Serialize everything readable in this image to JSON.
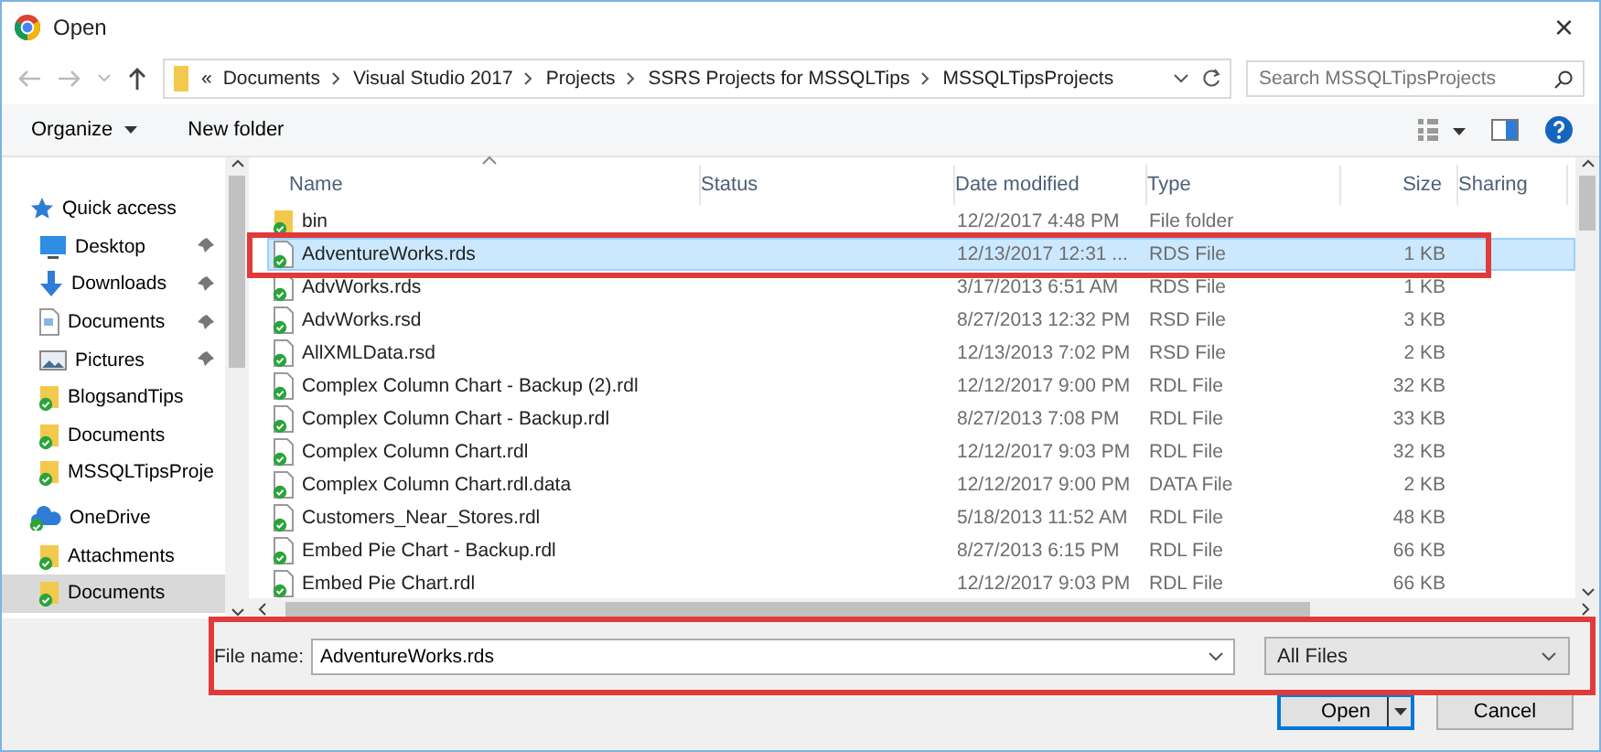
{
  "window": {
    "title": "Open",
    "close": "×"
  },
  "nav": {
    "path_prefix": "«",
    "path": [
      "Documents",
      "Visual Studio 2017",
      "Projects",
      "SSRS Projects for MSSQLTips",
      "MSSQLTipsProjects"
    ],
    "search_placeholder": "Search MSSQLTipsProjects"
  },
  "toolbar": {
    "organize": "Organize",
    "new_folder": "New folder"
  },
  "sidebar": {
    "items": [
      {
        "label": "Quick access",
        "kind": "star",
        "pinned": false,
        "selected": false,
        "top": true
      },
      {
        "label": "Desktop",
        "kind": "desktop",
        "pinned": true,
        "selected": false,
        "top": false
      },
      {
        "label": "Downloads",
        "kind": "download",
        "pinned": true,
        "selected": false,
        "top": false
      },
      {
        "label": "Documents",
        "kind": "document",
        "pinned": true,
        "selected": false,
        "top": false
      },
      {
        "label": "Pictures",
        "kind": "picture",
        "pinned": true,
        "selected": false,
        "top": false
      },
      {
        "label": "BlogsandTips",
        "kind": "folder",
        "pinned": false,
        "selected": false,
        "top": false
      },
      {
        "label": "Documents",
        "kind": "folder",
        "pinned": false,
        "selected": false,
        "top": false
      },
      {
        "label": "MSSQLTipsProje",
        "kind": "folder",
        "pinned": false,
        "selected": false,
        "top": false
      },
      {
        "label": "OneDrive",
        "kind": "cloud",
        "pinned": false,
        "selected": false,
        "top": true
      },
      {
        "label": "Attachments",
        "kind": "folder",
        "pinned": false,
        "selected": false,
        "top": false
      },
      {
        "label": "Documents",
        "kind": "folder",
        "pinned": false,
        "selected": true,
        "top": false
      }
    ]
  },
  "table": {
    "columns": [
      "Name",
      "Status",
      "Date modified",
      "Type",
      "Size",
      "Sharing"
    ],
    "rows": [
      {
        "name": "bin",
        "kind": "folder",
        "date": "12/2/2017 4:48 PM",
        "type": "File folder",
        "size": "",
        "selected": false
      },
      {
        "name": "AdventureWorks.rds",
        "kind": "file",
        "date": "12/13/2017 12:31 ...",
        "type": "RDS File",
        "size": "1 KB",
        "selected": true
      },
      {
        "name": "AdvWorks.rds",
        "kind": "file",
        "date": "3/17/2013 6:51 AM",
        "type": "RDS File",
        "size": "1 KB",
        "selected": false
      },
      {
        "name": "AdvWorks.rsd",
        "kind": "file",
        "date": "8/27/2013 12:32 PM",
        "type": "RSD File",
        "size": "3 KB",
        "selected": false
      },
      {
        "name": "AllXMLData.rsd",
        "kind": "file",
        "date": "12/13/2013 7:02 PM",
        "type": "RSD File",
        "size": "2 KB",
        "selected": false
      },
      {
        "name": "Complex Column Chart - Backup (2).rdl",
        "kind": "file",
        "date": "12/12/2017 9:00 PM",
        "type": "RDL File",
        "size": "32 KB",
        "selected": false
      },
      {
        "name": "Complex Column Chart - Backup.rdl",
        "kind": "file",
        "date": "8/27/2013 7:08 PM",
        "type": "RDL File",
        "size": "33 KB",
        "selected": false
      },
      {
        "name": "Complex Column Chart.rdl",
        "kind": "file",
        "date": "12/12/2017 9:03 PM",
        "type": "RDL File",
        "size": "32 KB",
        "selected": false
      },
      {
        "name": "Complex Column Chart.rdl.data",
        "kind": "file",
        "date": "12/12/2017 9:00 PM",
        "type": "DATA File",
        "size": "2 KB",
        "selected": false
      },
      {
        "name": "Customers_Near_Stores.rdl",
        "kind": "file",
        "date": "5/18/2013 11:52 AM",
        "type": "RDL File",
        "size": "48 KB",
        "selected": false
      },
      {
        "name": "Embed Pie Chart - Backup.rdl",
        "kind": "file",
        "date": "8/27/2013 6:15 PM",
        "type": "RDL File",
        "size": "66 KB",
        "selected": false
      },
      {
        "name": "Embed Pie Chart.rdl",
        "kind": "file",
        "date": "12/12/2017 9:03 PM",
        "type": "RDL File",
        "size": "66 KB",
        "selected": false
      }
    ]
  },
  "file_name": {
    "label": "File name:",
    "value": "AdventureWorks.rds"
  },
  "filter": {
    "value": "All Files"
  },
  "buttons": [
    {
      "label": "Open",
      "kind": "split"
    },
    {
      "label": "Cancel",
      "kind": "plain"
    }
  ]
}
